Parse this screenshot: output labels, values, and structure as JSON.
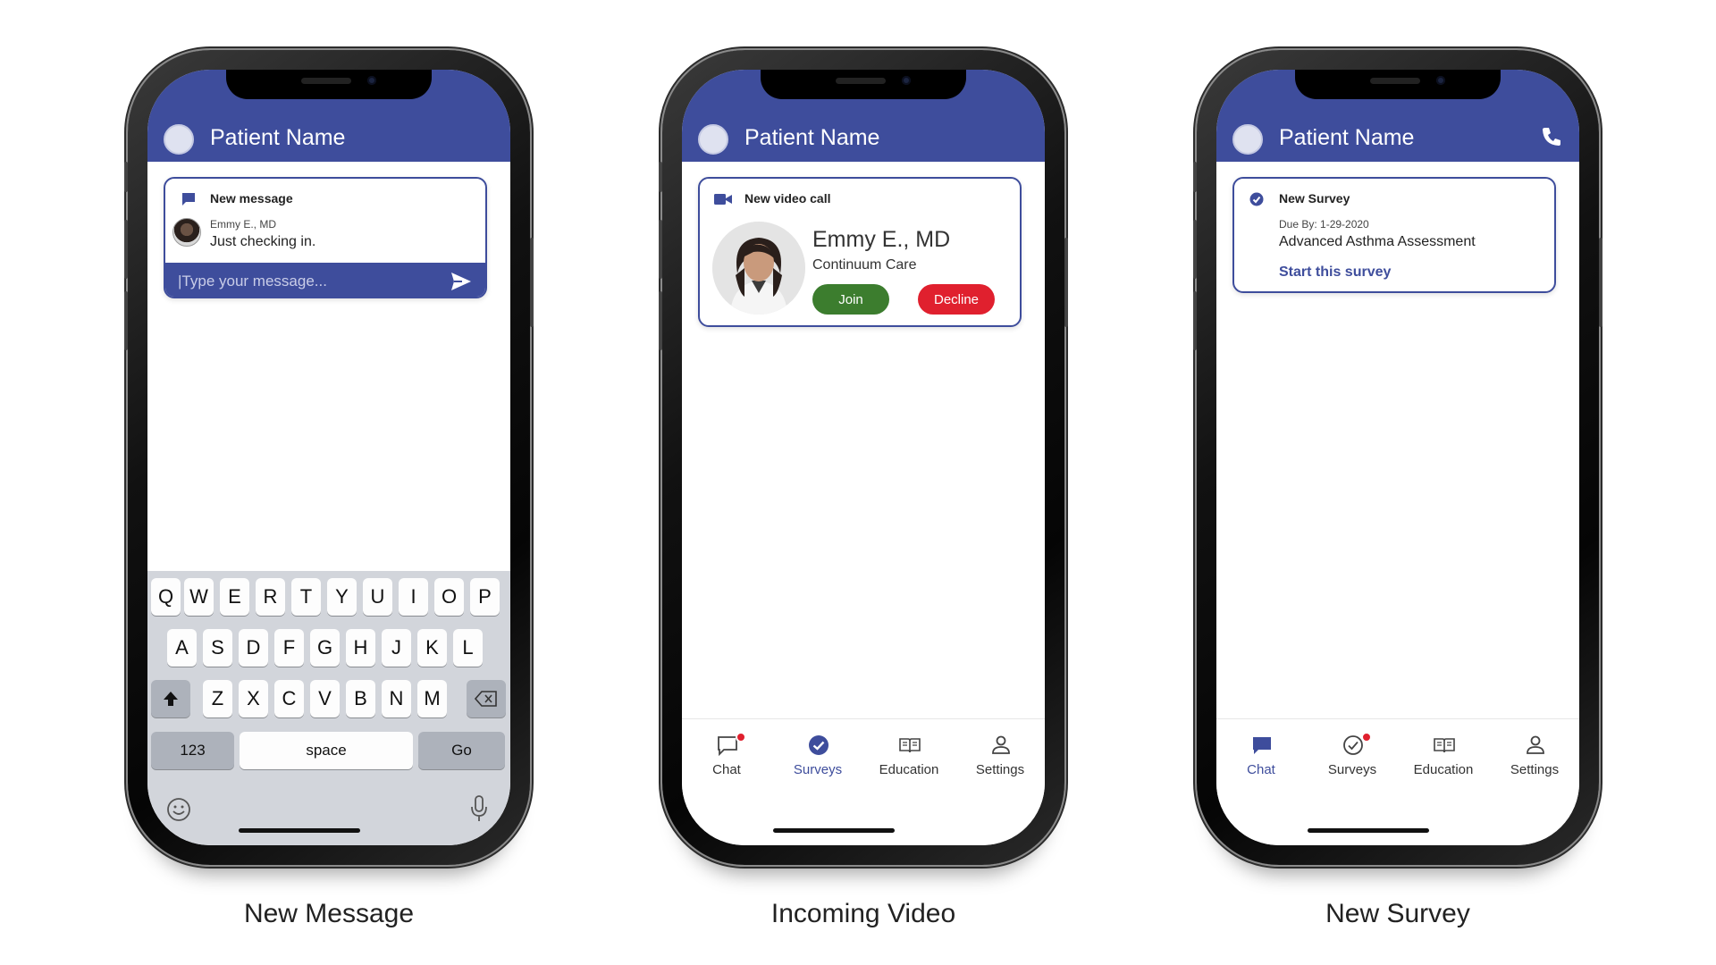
{
  "colors": {
    "brand": "#3e4d9c",
    "join": "#3c7d2e",
    "decline": "#e0202e",
    "badge": "#e0202e"
  },
  "phones": [
    {
      "caption": "New Message",
      "header": {
        "patient_name": "Patient Name"
      },
      "card": {
        "title": "New message",
        "sender": "Emmy E., MD",
        "message": "Just checking in.",
        "input_placeholder": "|Type your message..."
      },
      "keyboard": {
        "row1": [
          "Q",
          "W",
          "E",
          "R",
          "T",
          "Y",
          "U",
          "I",
          "O",
          "P"
        ],
        "row2": [
          "A",
          "S",
          "D",
          "F",
          "G",
          "H",
          "J",
          "K",
          "L"
        ],
        "row3": [
          "Z",
          "X",
          "C",
          "V",
          "B",
          "N",
          "M"
        ],
        "numbers_key": "123",
        "space_key": "space",
        "go_key": "Go"
      }
    },
    {
      "caption": "Incoming Video",
      "header": {
        "patient_name": "Patient Name"
      },
      "card": {
        "title": "New video call",
        "doctor_name": "Emmy E., MD",
        "organization": "Continuum Care",
        "join_label": "Join",
        "decline_label": "Decline"
      },
      "tabs": {
        "chat": "Chat",
        "surveys": "Surveys",
        "education": "Education",
        "settings": "Settings",
        "active": "surveys",
        "badge_on": "chat"
      }
    },
    {
      "caption": "New Survey",
      "header": {
        "patient_name": "Patient Name"
      },
      "card": {
        "title": "New Survey",
        "due": "Due By: 1-29-2020",
        "survey_name": "Advanced Asthma Assessment",
        "start_label": "Start this survey"
      },
      "tabs": {
        "chat": "Chat",
        "surveys": "Surveys",
        "education": "Education",
        "settings": "Settings",
        "active": "chat",
        "badge_on": "surveys"
      }
    }
  ]
}
